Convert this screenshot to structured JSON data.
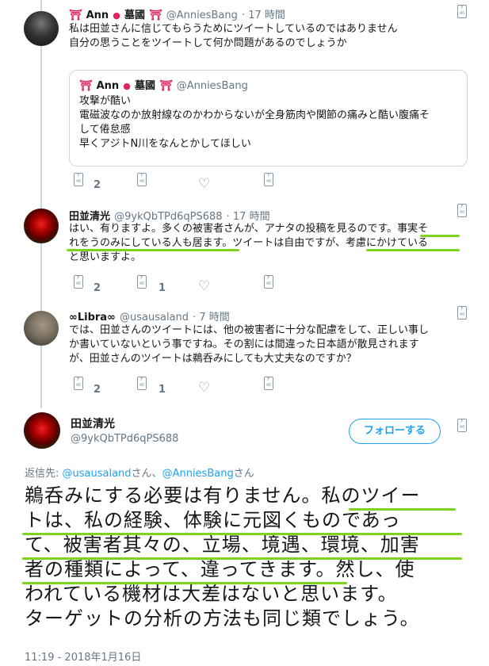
{
  "tweets": [
    {
      "name": "Ann",
      "name_suffix": "墓國",
      "handle": "@AnniesBang",
      "time": "· 17 時間",
      "lines": [
        "私は田並さんに信じてもらうためにツイートしているのではありません",
        "自分の思うことをツイートして何か問題があるのでしょうか"
      ],
      "quote": {
        "name": "Ann",
        "name_suffix": "墓國",
        "handle": "@AnniesBang",
        "lines": [
          "攻撃が酷い",
          "電磁波なのか放射線なのかわからないが全身筋肉や関節の痛みと酷い腹痛そ",
          "して倦怠感",
          "早くアジトN川をなんとかしてほしい"
        ]
      },
      "reply_count": "2"
    },
    {
      "name": "田並清光",
      "handle": "@9ykQbTPd6qPS688",
      "time": "· 17 時間",
      "lines": [
        "はい、有りますよ。多くの被害者さんが、アナタの投稿を見るのです。事実そ",
        "れをうのみにしている人も居ます。ツイートは自由ですが、考慮にかけている",
        "と思いますよ。"
      ],
      "reply_count": "2",
      "retweet_count": "1"
    },
    {
      "name": "∞Libra∞",
      "handle": "@usausaland",
      "time": "· 7 時間",
      "lines": [
        "では、田並さんのツイートには、他の被害者に十分な配慮をして、正しい事し",
        "か書いていないという事ですね。その割には間違った日本語が散見されます",
        "が、田並さんのツイートは鵜呑みにしても大丈夫なのですか？"
      ],
      "reply_count": "2",
      "retweet_count": "1"
    }
  ],
  "main": {
    "name": "田並清光",
    "handle": "@9ykQbTPd6qPS688",
    "follow_label": "フォローする",
    "reply_to_prefix": "返信先: ",
    "reply_to_user1": "@usausaland",
    "reply_to_mid": "さん、",
    "reply_to_user2": "@AnniesBang",
    "reply_to_suffix": "さん",
    "lines": [
      "鵜呑みにする必要は有りません。私のツイー",
      "トは、私の経験、体験に元図くものであっ",
      "て、被害者其々の、立場、境遇、環境、加害",
      "者の種類によって、違ってきます。然し、使",
      "われている機材は大差はないと思います。",
      "ターゲットの分析の方法も同じ類でしょう。"
    ],
    "timestamp": "11:19 - 2018年1月16日"
  },
  "icon_text": "F 46",
  "colors": {
    "accent": "#1da1f2",
    "underline": "#7ed321",
    "shrine": "#e0245e"
  }
}
